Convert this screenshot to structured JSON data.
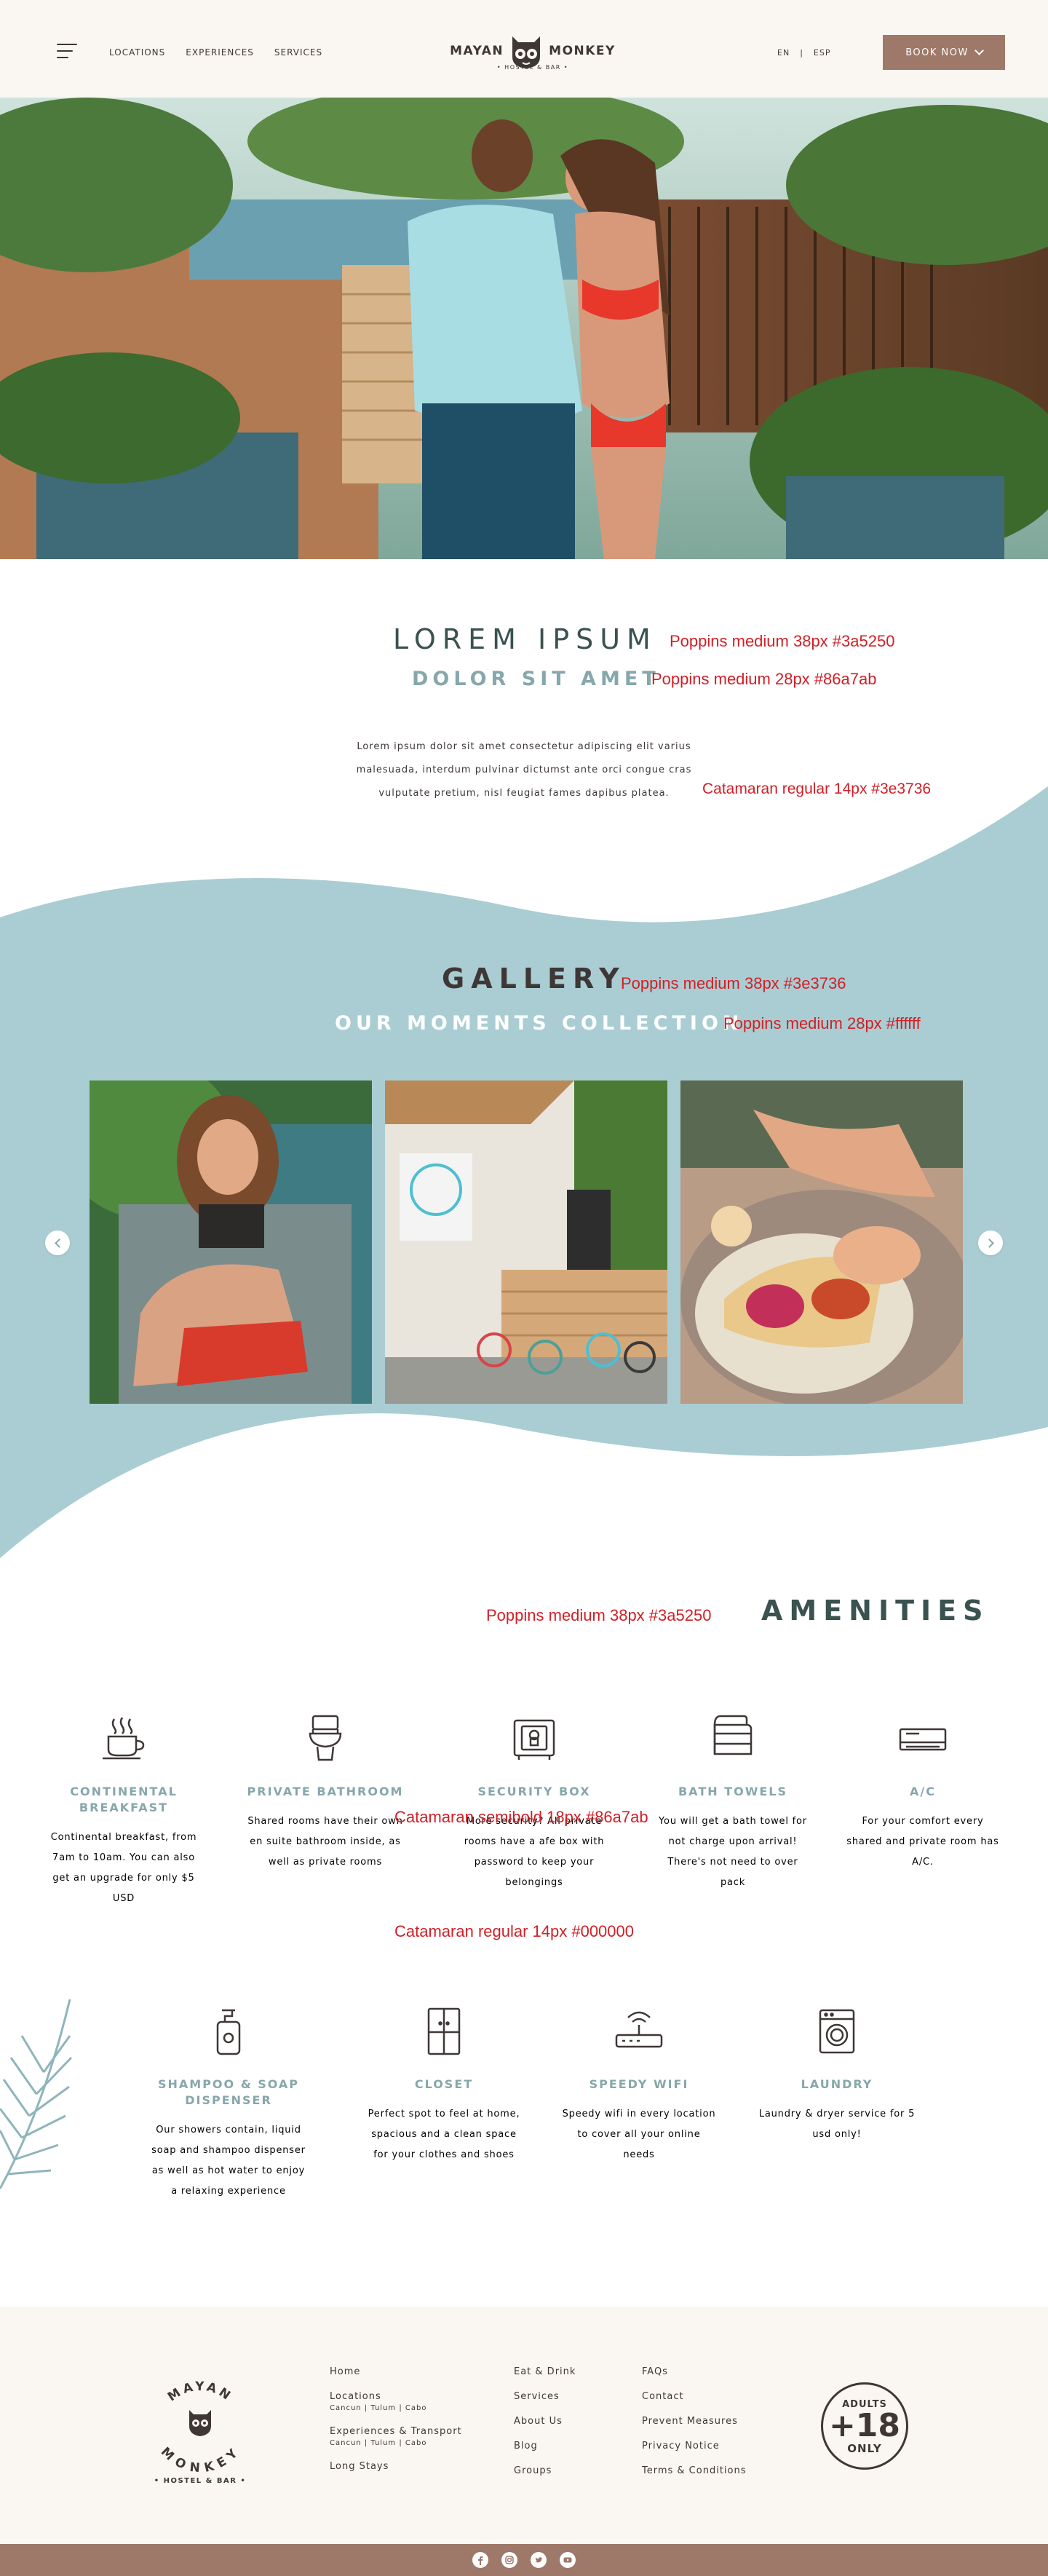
{
  "header": {
    "nav": [
      "LOCATIONS",
      "EXPERIENCES",
      "SERVICES"
    ],
    "logo_left": "MAYAN",
    "logo_right": "MONKEY",
    "logo_sub": "• HOSTEL & BAR •",
    "lang_en": "EN",
    "lang_sep": "|",
    "lang_esp": "ESP",
    "book_label": "BOOK NOW"
  },
  "intro": {
    "title": "LOREM IPSUM",
    "title_note": "Poppins medium 38px #3a5250",
    "subtitle": "DOLOR SIT AMET",
    "subtitle_note": "Poppins medium 28px #86a7ab",
    "body_lines": [
      "Lorem ipsum dolor sit amet consectetur adipiscing elit varius",
      "malesuada, interdum pulvinar dictumst ante orci congue cras",
      "vulputate pretium, nisl feugiat fames dapibus platea."
    ],
    "body_note": "Catamaran regular 14px #3e3736"
  },
  "gallery": {
    "title": "GALLERY",
    "title_note": "Poppins medium 38px #3e3736",
    "subtitle": "OUR MOMENTS COLLECTION",
    "subtitle_note": "Poppins medium 28px #ffffff",
    "photos": [
      "woman-smiling-photo",
      "hostel-entrance-photo",
      "tacos-plate-photo"
    ]
  },
  "amenities": {
    "title": "AMENITIES",
    "title_note": "Poppins medium 38px #3a5250",
    "label_note": "Catamaran semibold 18px #86a7ab",
    "desc_note": "Catamaran regular 14px #000000",
    "row1": [
      {
        "icon": "coffee-cup-icon",
        "title": "CONTINENTAL BREAKFAST",
        "desc": "Continental breakfast, from 7am to 10am. You can also get an upgrade for only $5 USD"
      },
      {
        "icon": "toilet-icon",
        "title": "PRIVATE BATHROOM",
        "desc": "Shared rooms have their own en suite bathroom inside, as well as private rooms"
      },
      {
        "icon": "safe-box-icon",
        "title": "SECURITY BOX",
        "desc": "More security? All private rooms have a  afe box with password to keep your belongings"
      },
      {
        "icon": "towels-icon",
        "title": "BATH TOWELS",
        "desc": "You will get a bath towel for not charge upon arrival! There's not need to over pack"
      },
      {
        "icon": "air-conditioner-icon",
        "title": "A/C",
        "desc": "For your comfort every shared and private room has A/C."
      }
    ],
    "row2": [
      {
        "icon": "soap-dispenser-icon",
        "title": "SHAMPOO & SOAP DISPENSER",
        "desc": "Our showers contain, liquid soap and shampoo dispenser as well as hot water to enjoy a relaxing experience"
      },
      {
        "icon": "closet-icon",
        "title": "CLOSET",
        "desc": "Perfect spot to feel at home, spacious and a clean space for your clothes and shoes"
      },
      {
        "icon": "wifi-router-icon",
        "title": "SPEEDY WIFI",
        "desc": "Speedy wifi in every location to cover all your online needs"
      },
      {
        "icon": "washing-machine-icon",
        "title": "LAUNDRY",
        "desc": "Laundry & dryer service for 5 usd only!"
      }
    ]
  },
  "footer": {
    "logo_top": "MAYAN",
    "logo_bottom": "MONKEY",
    "logo_sub": "• HOSTEL & BAR •",
    "col1": [
      {
        "label": "Home",
        "sub": ""
      },
      {
        "label": "Locations",
        "sub": "Cancun | Tulum | Cabo"
      },
      {
        "label": "Experiences & Transport",
        "sub": "Cancun | Tulum | Cabo"
      },
      {
        "label": "Long Stays",
        "sub": ""
      }
    ],
    "col2": [
      "Eat & Drink",
      "Services",
      "About Us",
      "Blog",
      "Groups"
    ],
    "col3": [
      "FAQs",
      "Contact",
      "Prevent Measures",
      "Privacy Notice",
      "Terms & Conditions"
    ],
    "adult_top": "ADULTS",
    "adult_mid": "+18",
    "adult_bottom": "ONLY",
    "social": [
      "facebook-icon",
      "instagram-icon",
      "twitter-icon",
      "youtube-icon"
    ]
  },
  "colors": {
    "dark_teal": "#3a5250",
    "light_teal": "#86a7ab",
    "text": "#3e3736",
    "brown": "#9e7868",
    "gallery_bg": "#a9cdd3",
    "cream": "#faf6f2",
    "note_red": "#d21f26"
  }
}
